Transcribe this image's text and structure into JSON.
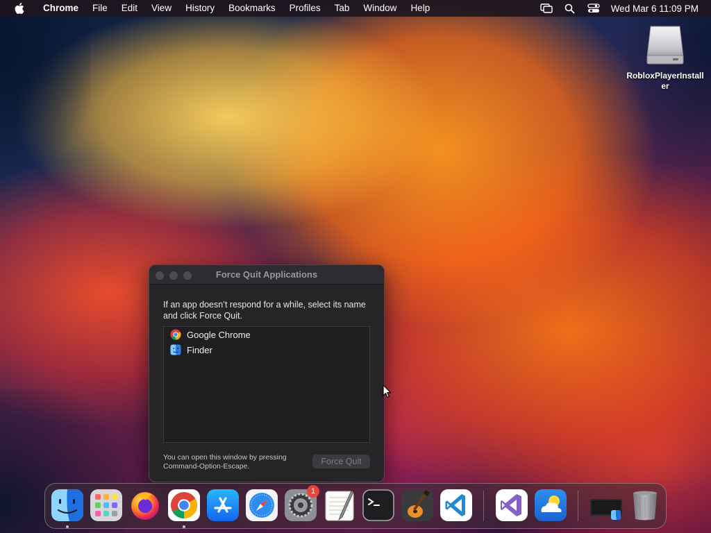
{
  "menubar": {
    "app_name": "Chrome",
    "items": [
      "File",
      "Edit",
      "View",
      "History",
      "Bookmarks",
      "Profiles",
      "Tab",
      "Window",
      "Help"
    ],
    "clock": "Wed Mar 6  11:09 PM",
    "status_icons": [
      "screen-mirroring-icon",
      "spotlight-search-icon",
      "control-center-icon"
    ]
  },
  "desktop": {
    "icon_label": "RobloxPlayerInstaller",
    "icon_type": "disk-image-icon"
  },
  "force_quit": {
    "title": "Force Quit Applications",
    "instructions": "If an app doesn’t respond for a while, select its name and click Force Quit.",
    "apps": [
      {
        "name": "Google Chrome",
        "icon": "chrome-icon"
      },
      {
        "name": "Finder",
        "icon": "finder-icon"
      }
    ],
    "footer": "You can open this window by pressing Command-Option-Escape.",
    "button_label": "Force Quit"
  },
  "dock": {
    "apps": [
      {
        "name": "Finder",
        "icon": "finder-icon",
        "running": true
      },
      {
        "name": "Launchpad",
        "icon": "launchpad-icon",
        "running": false
      },
      {
        "name": "Firefox",
        "icon": "firefox-icon",
        "running": false
      },
      {
        "name": "Google Chrome",
        "icon": "chrome-icon",
        "running": true
      },
      {
        "name": "App Store",
        "icon": "app-store-icon",
        "running": false
      },
      {
        "name": "Safari",
        "icon": "safari-icon",
        "running": false
      },
      {
        "name": "System Settings",
        "icon": "system-settings-icon",
        "running": false,
        "badge": "1"
      },
      {
        "name": "TextEdit",
        "icon": "textedit-icon",
        "running": false
      },
      {
        "name": "Terminal",
        "icon": "terminal-icon",
        "running": false
      },
      {
        "name": "GarageBand",
        "icon": "garageband-icon",
        "running": false
      },
      {
        "name": "Visual Studio Code",
        "icon": "vscode-icon",
        "running": false
      },
      {
        "name": "Visual Studio",
        "icon": "visual-studio-icon",
        "running": false
      },
      {
        "name": "Weather",
        "icon": "weather-icon",
        "running": false
      },
      {
        "name": "Downloads",
        "icon": "downloads-stack-icon",
        "running": false
      },
      {
        "name": "Trash",
        "icon": "trash-icon",
        "running": false
      }
    ]
  },
  "colors": {
    "menubar_bg": "#1e161e",
    "window_bg": "#262427",
    "badge_red": "#e5453a"
  }
}
